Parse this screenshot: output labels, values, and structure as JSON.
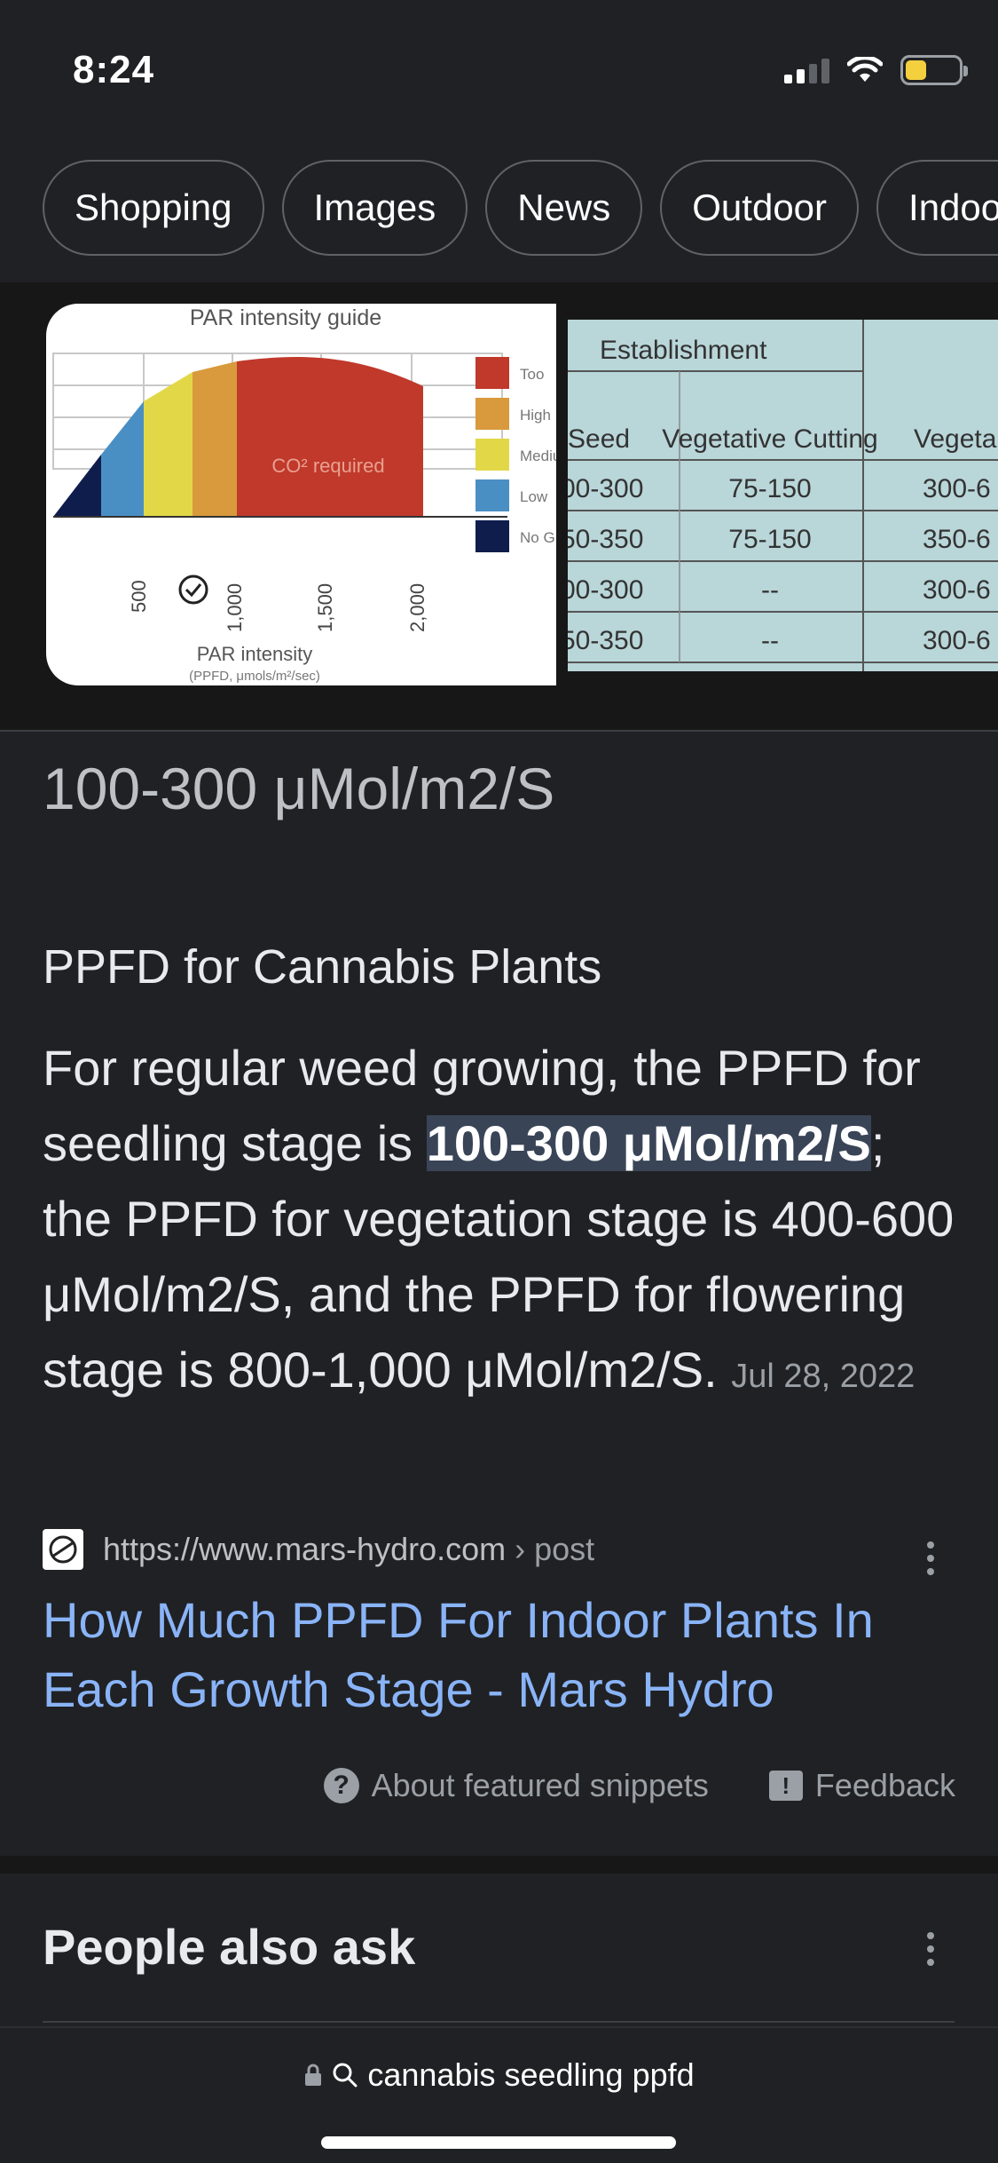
{
  "status": {
    "time": "8:24"
  },
  "chips": [
    "Shopping",
    "Images",
    "News",
    "Outdoor",
    "Indoor"
  ],
  "image1": {
    "title": "PAR intensity guide",
    "legend": [
      "Too",
      "High",
      "Medium",
      "Low",
      "No G"
    ],
    "annotation": "CO² required",
    "ticks": [
      "500",
      "1,000",
      "1,500",
      "2,000"
    ],
    "xlabel": "PAR intensity",
    "xsub": "(PPFD, μmols/m²/sec)",
    "colors": {
      "too": "#c0392b",
      "high": "#d89a3c",
      "medium": "#e2d847",
      "low": "#4a8fc4",
      "none": "#0f1d4d"
    }
  },
  "image2": {
    "group": "Establishment",
    "headers": [
      "Seed",
      "Vegetative Cutting",
      "Vegeta"
    ],
    "rows": [
      [
        "00-300",
        "75-150",
        "300-6"
      ],
      [
        "50-350",
        "75-150",
        "350-6"
      ],
      [
        "00-300",
        "--",
        "300-6"
      ],
      [
        "50-350",
        "--",
        "300-6"
      ]
    ]
  },
  "answer": "100-300 μMol/m2/S",
  "heading": "PPFD for Cannabis Plants",
  "snippet": {
    "pre": "For regular weed growing, the PPFD for seedling stage is ",
    "highlight": "100-300 μMol/m2/S",
    "post": "; the PPFD for vegetation stage is 400-600 μMol/m2/S, and the PPFD for flowering stage is 800-1,000 μMol/m2/S.",
    "date": "Jul 28, 2022"
  },
  "source": {
    "url": "https://www.mars-hydro.com",
    "crumb": " › post",
    "title": "How Much PPFD For Indoor Plants In Each Growth Stage - Mars Hydro"
  },
  "footer": {
    "about": "About featured snippets",
    "feedback": "Feedback"
  },
  "paa": "People also ask",
  "address": "cannabis seedling ppfd"
}
